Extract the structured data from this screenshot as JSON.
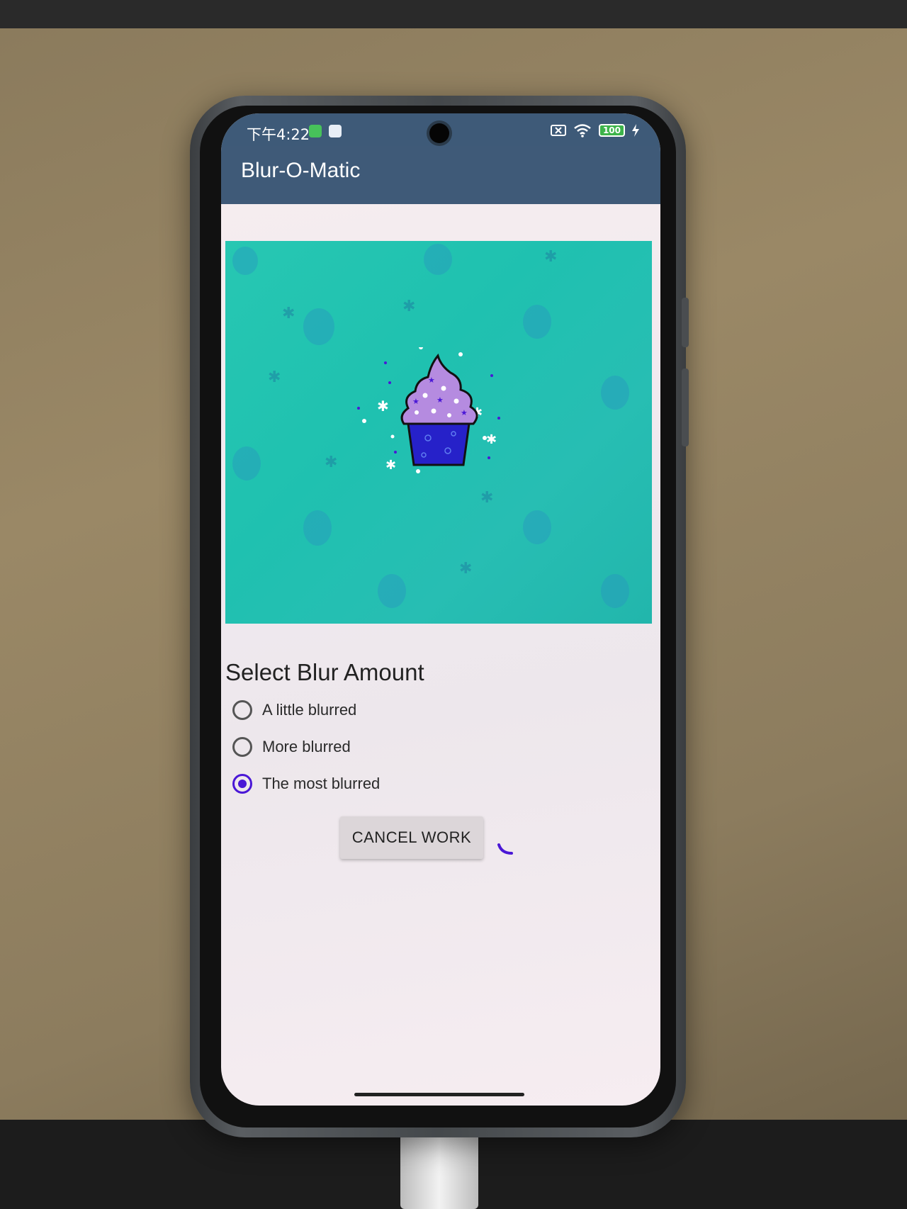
{
  "status_bar": {
    "time": "下午4:22",
    "battery": "100"
  },
  "app": {
    "title": "Blur-O-Matic"
  },
  "image": {
    "subject": "cupcake"
  },
  "blur_section": {
    "title": "Select Blur Amount",
    "options": [
      {
        "label": "A little blurred",
        "selected": false
      },
      {
        "label": "More blurred",
        "selected": false
      },
      {
        "label": "The most blurred",
        "selected": true
      }
    ]
  },
  "actions": {
    "cancel_label": "CANCEL WORK"
  },
  "colors": {
    "app_bar": "#3f5a78",
    "accent": "#4a17d6",
    "image_background": "#27c7b2"
  },
  "icons": {
    "spinner": "progress-spinner-icon",
    "wifi": "wifi-icon",
    "no_sim": "no-sim-icon",
    "charging": "charging-bolt-icon"
  }
}
